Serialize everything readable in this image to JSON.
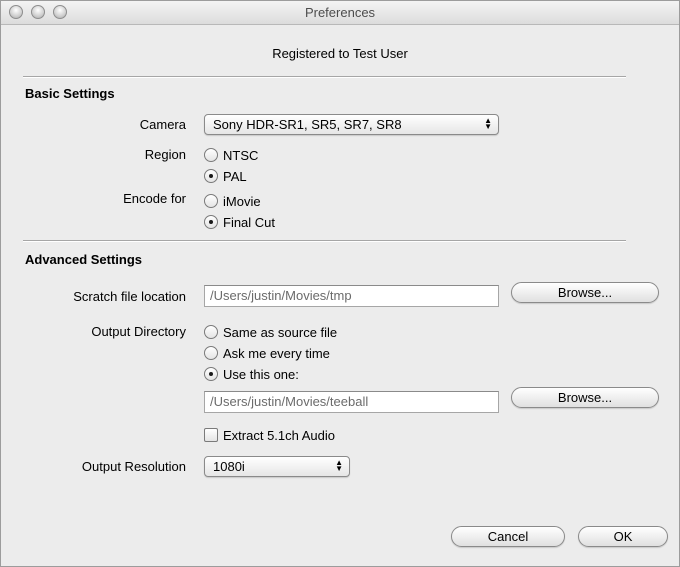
{
  "window": {
    "title": "Preferences"
  },
  "registration": "Registered to Test User",
  "basic": {
    "heading": "Basic Settings",
    "camera": {
      "label": "Camera",
      "value": "Sony HDR-SR1, SR5, SR7, SR8"
    },
    "region": {
      "label": "Region",
      "options": [
        "NTSC",
        "PAL"
      ],
      "selected": "PAL"
    },
    "encode": {
      "label": "Encode for",
      "options": [
        "iMovie",
        "Final Cut"
      ],
      "selected": "Final Cut"
    }
  },
  "advanced": {
    "heading": "Advanced Settings",
    "scratch": {
      "label": "Scratch file location",
      "value": "/Users/justin/Movies/tmp",
      "browse": "Browse..."
    },
    "output_dir": {
      "label": "Output Directory",
      "options": [
        "Same as source file",
        "Ask me every time",
        "Use this one:"
      ],
      "selected": "Use this one:",
      "value": "/Users/justin/Movies/teeball",
      "browse": "Browse..."
    },
    "extract_audio": {
      "label": "Extract 5.1ch Audio",
      "checked": false
    },
    "resolution": {
      "label": "Output Resolution",
      "value": "1080i"
    }
  },
  "buttons": {
    "cancel": "Cancel",
    "ok": "OK"
  }
}
